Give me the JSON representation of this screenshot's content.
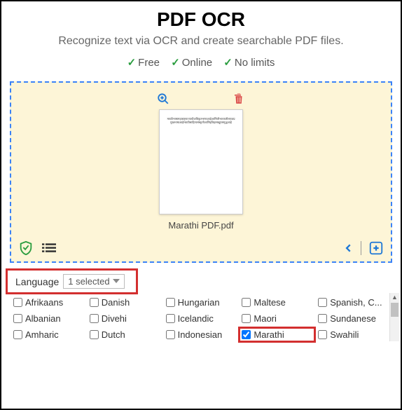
{
  "header": {
    "title": "PDF OCR",
    "subtitle": "Recognize text via OCR and create searchable PDF files.",
    "features": [
      "Free",
      "Online",
      "No limits"
    ]
  },
  "file": {
    "name": "Marathi PDF.pdf"
  },
  "language": {
    "label": "Language",
    "selected_text": "1 selected"
  },
  "languages": [
    {
      "label": "Afrikaans",
      "checked": false
    },
    {
      "label": "Danish",
      "checked": false
    },
    {
      "label": "Hungarian",
      "checked": false
    },
    {
      "label": "Maltese",
      "checked": false
    },
    {
      "label": "Spanish, C...",
      "checked": false
    },
    {
      "label": "Albanian",
      "checked": false
    },
    {
      "label": "Divehi",
      "checked": false
    },
    {
      "label": "Icelandic",
      "checked": false
    },
    {
      "label": "Maori",
      "checked": false
    },
    {
      "label": "Sundanese",
      "checked": false
    },
    {
      "label": "Amharic",
      "checked": false
    },
    {
      "label": "Dutch",
      "checked": false
    },
    {
      "label": "Indonesian",
      "checked": false
    },
    {
      "label": "Marathi",
      "checked": true,
      "highlight": true
    },
    {
      "label": "Swahili",
      "checked": false
    }
  ]
}
